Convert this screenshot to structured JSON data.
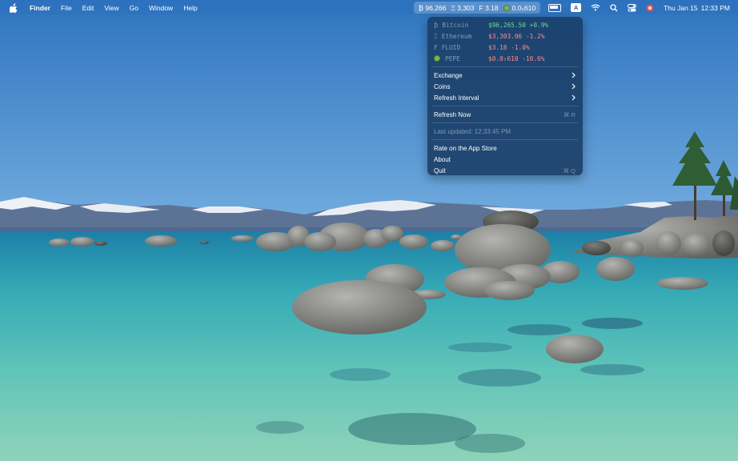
{
  "menubar": {
    "app_name": "Finder",
    "menus": [
      "File",
      "Edit",
      "View",
      "Go",
      "Window",
      "Help"
    ],
    "ticker": {
      "btc": "₿ 96,266",
      "eth": "Ξ 3,303",
      "fluid": "F 3.18",
      "pepe": "0.0₅610"
    },
    "clock": {
      "date": "Thu Jan 15",
      "time": "12:33 PM"
    }
  },
  "dropdown": {
    "coins": [
      {
        "symbol": "₿",
        "name": "Bitcoin",
        "price": "$96,265.50",
        "change": "+0.9%",
        "trend": "up"
      },
      {
        "symbol": "Ξ",
        "name": "Ethereum",
        "price": "$3,303.06",
        "change": "-1.2%",
        "trend": "down"
      },
      {
        "symbol": "F",
        "name": "FLUID",
        "price": "$3.18",
        "change": "-1.0%",
        "trend": "down"
      },
      {
        "symbol": "pepe-icon",
        "name": "PEPE",
        "price": "$0.0₅610",
        "change": "-10.6%",
        "trend": "down"
      }
    ],
    "submenus": [
      "Exchange",
      "Coins",
      "Refresh Interval"
    ],
    "refresh_label": "Refresh Now",
    "refresh_shortcut": "⌘ R",
    "last_updated": "Last updated: 12:33:45 PM",
    "rate_label": "Rate on the App Store",
    "about_label": "About",
    "quit_label": "Quit",
    "quit_shortcut": "⌘ Q"
  },
  "colors": {
    "up": "#6fdc8c",
    "down": "#ff8a8a"
  }
}
